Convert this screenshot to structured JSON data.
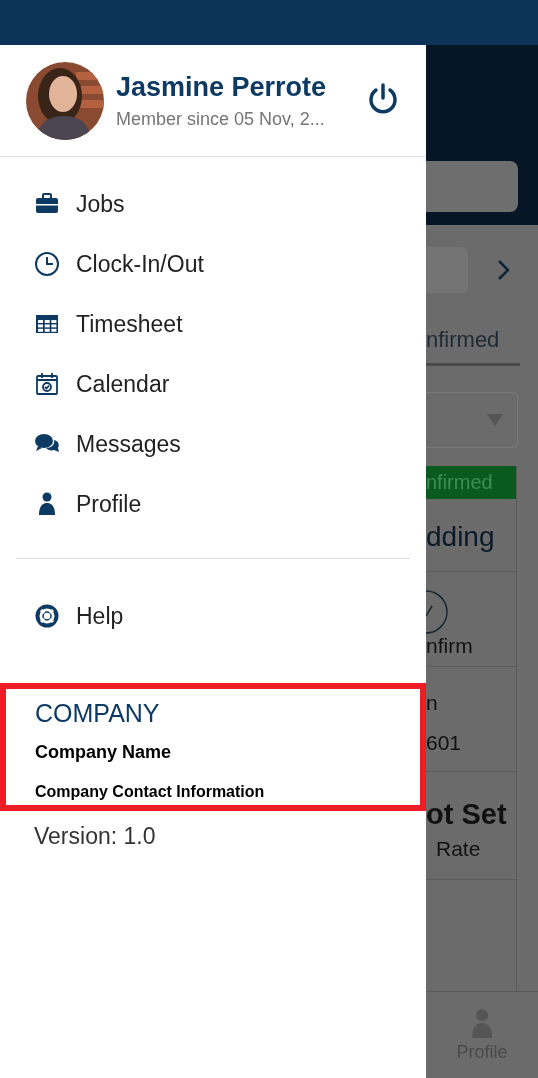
{
  "drawer": {
    "user": {
      "name": "Jasmine Perrote",
      "member_since": "Member since 05 Nov, 2..."
    },
    "menu": [
      {
        "label": "Jobs"
      },
      {
        "label": "Clock-In/Out"
      },
      {
        "label": "Timesheet"
      },
      {
        "label": "Calendar"
      },
      {
        "label": "Messages"
      },
      {
        "label": "Profile"
      },
      {
        "label": "Help"
      }
    ],
    "company": {
      "heading": "COMPANY",
      "name": "Company Name",
      "contact": "Company Contact Information",
      "highlighted": true
    },
    "version": "Version: 1.0"
  },
  "background": {
    "tab_label": "nfirmed",
    "status_badge": "nfirmed",
    "card_title": "dding",
    "confirm_label": "nfirm",
    "field_label": "n",
    "field_value": "601",
    "rate_value": "ot Set",
    "rate_label": "Rate",
    "bottom_nav": {
      "label": "Profile"
    }
  }
}
